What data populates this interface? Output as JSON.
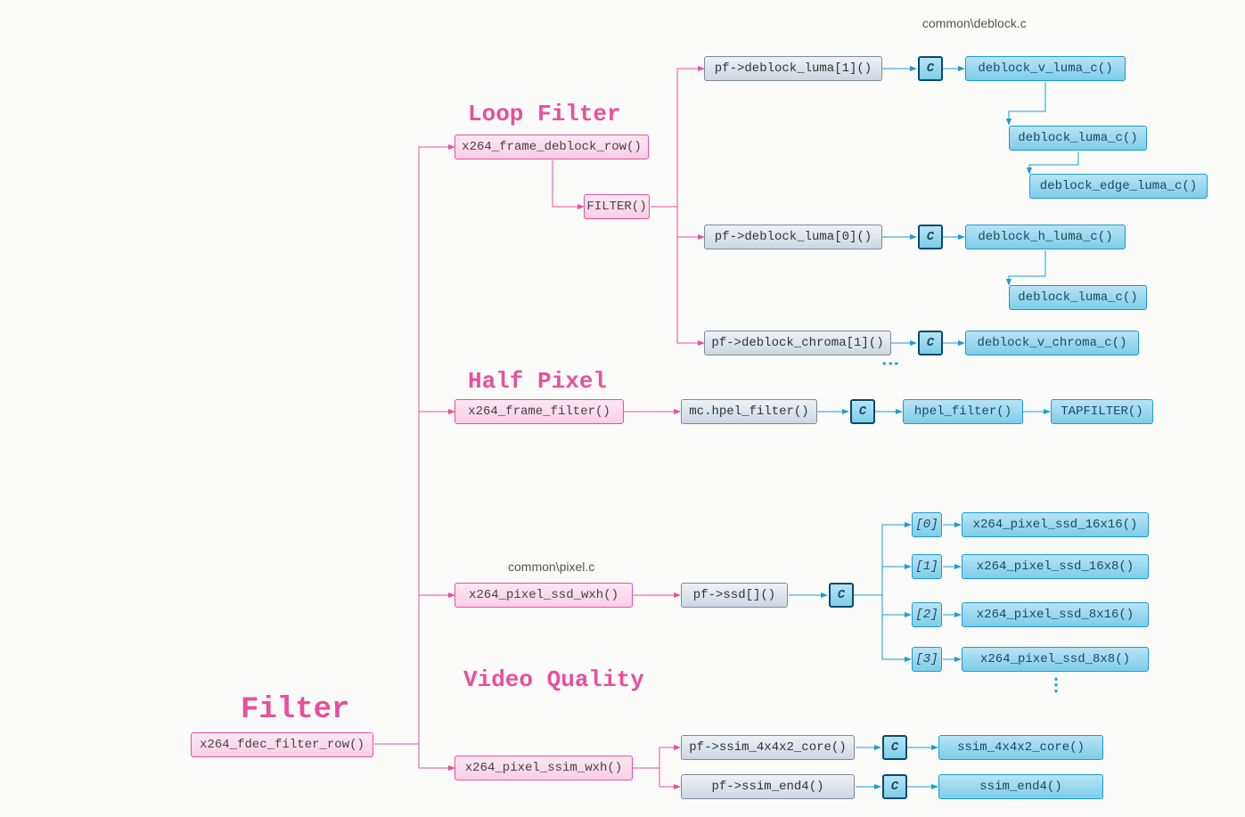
{
  "titles": {
    "main": "Filter",
    "loopFilter": "Loop Filter",
    "halfPixel": "Half Pixel",
    "videoQuality": "Video Quality"
  },
  "fileLabels": {
    "deblock": "common\\deblock.c",
    "pixel": "common\\pixel.c"
  },
  "root": {
    "label": "x264_fdec_filter_row()"
  },
  "loopFilter": {
    "frame": "x264_frame_deblock_row()",
    "filter": "FILTER()",
    "deblockLuma1": "pf->deblock_luma[1]()",
    "deblockLuma0": "pf->deblock_luma[0]()",
    "deblockChroma1": "pf->deblock_chroma[1]()",
    "vLumaC": "deblock_v_luma_c()",
    "lumaC1": "deblock_luma_c()",
    "edgeLumaC": "deblock_edge_luma_c()",
    "hLumaC": "deblock_h_luma_c()",
    "lumaC2": "deblock_luma_c()",
    "vChromaC": "deblock_v_chroma_c()",
    "c1": "C",
    "c2": "C",
    "c3": "C"
  },
  "halfPixel": {
    "frame": "x264_frame_filter()",
    "mcHpel": "mc.hpel_filter()",
    "hpelFilter": "hpel_filter()",
    "tapFilter": "TAPFILTER()",
    "c": "C"
  },
  "ssd": {
    "wxh": "x264_pixel_ssd_wxh()",
    "pfSsd": "pf->ssd[]()",
    "c": "C",
    "idx": [
      "[0]",
      "[1]",
      "[2]",
      "[3]"
    ],
    "funcs": [
      "x264_pixel_ssd_16x16()",
      "x264_pixel_ssd_16x8()",
      "x264_pixel_ssd_8x16()",
      "x264_pixel_ssd_8x8()"
    ]
  },
  "ssim": {
    "wxh": "x264_pixel_ssim_wxh()",
    "core": "pf->ssim_4x4x2_core()",
    "end4": "pf->ssim_end4()",
    "coreOut": "ssim_4x4x2_core()",
    "end4Out": "ssim_end4()",
    "c1": "C",
    "c2": "C"
  }
}
